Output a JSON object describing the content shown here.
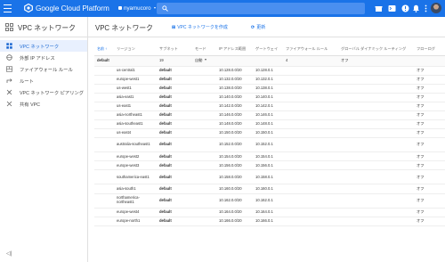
{
  "topbar": {
    "brand": "Google Cloud Platform",
    "project": "nyamucoro",
    "accent": "#1a73e8"
  },
  "sidebar": {
    "title": "VPC ネットワーク",
    "items": [
      {
        "label": "VPC ネットワーク",
        "icon": "vpc-network-icon",
        "active": true
      },
      {
        "label": "外部 IP アドレス",
        "icon": "ip-address-icon"
      },
      {
        "label": "ファイアウォール ルール",
        "icon": "firewall-icon"
      },
      {
        "label": "ルート",
        "icon": "route-icon"
      },
      {
        "label": "VPC ネットワーク ピアリング",
        "icon": "peering-icon"
      },
      {
        "label": "共有 VPC",
        "icon": "shared-vpc-icon"
      }
    ],
    "collapse": "◁|"
  },
  "main": {
    "title": "VPC ネットワーク",
    "create_label": "VPC ネットワークを作成",
    "refresh_label": "更新"
  },
  "table": {
    "headers": [
      "名前 ↑",
      "リージョン",
      "サブネット",
      "モード",
      "IP アドレス範囲",
      "ゲートウェイ",
      "ファイアウォール ルール",
      "グローバル ダイナミック ルーティング",
      "フローログ"
    ],
    "network": {
      "name": "default",
      "subnets": "19",
      "mode": "自動",
      "firewall": "4",
      "routing": "オフ"
    },
    "rows": [
      {
        "region": "us-central1",
        "subnet": "default",
        "range": "10.128.0.0/20",
        "gateway": "10.128.0.1",
        "flow": "オフ"
      },
      {
        "region": "europe-west1",
        "subnet": "default",
        "range": "10.132.0.0/20",
        "gateway": "10.132.0.1",
        "flow": "オフ"
      },
      {
        "region": "us-west1",
        "subnet": "default",
        "range": "10.138.0.0/20",
        "gateway": "10.138.0.1",
        "flow": "オフ"
      },
      {
        "region": "asia-east1",
        "subnet": "default",
        "range": "10.140.0.0/20",
        "gateway": "10.140.0.1",
        "flow": "オフ"
      },
      {
        "region": "us-east1",
        "subnet": "default",
        "range": "10.142.0.0/20",
        "gateway": "10.142.0.1",
        "flow": "オフ"
      },
      {
        "region": "asia-northeast1",
        "subnet": "default",
        "range": "10.146.0.0/20",
        "gateway": "10.146.0.1",
        "flow": "オフ"
      },
      {
        "region": "asia-southeast1",
        "subnet": "default",
        "range": "10.148.0.0/20",
        "gateway": "10.148.0.1",
        "flow": "オフ"
      },
      {
        "region": "us-east4",
        "subnet": "default",
        "range": "10.150.0.0/20",
        "gateway": "10.150.0.1",
        "flow": "オフ"
      },
      {
        "region": "australia-southeast1",
        "subnet": "default",
        "range": "10.152.0.0/20",
        "gateway": "10.152.0.1",
        "flow": "オフ"
      },
      {
        "region": "europe-west2",
        "subnet": "default",
        "range": "10.154.0.0/20",
        "gateway": "10.154.0.1",
        "flow": "オフ"
      },
      {
        "region": "europe-west3",
        "subnet": "default",
        "range": "10.156.0.0/20",
        "gateway": "10.156.0.1",
        "flow": "オフ"
      },
      {
        "region": "southamerica-east1",
        "subnet": "default",
        "range": "10.158.0.0/20",
        "gateway": "10.158.0.1",
        "flow": "オフ"
      },
      {
        "region": "asia-south1",
        "subnet": "default",
        "range": "10.160.0.0/20",
        "gateway": "10.160.0.1",
        "flow": "オフ"
      },
      {
        "region": "northamerica-northeast1",
        "subnet": "default",
        "range": "10.162.0.0/20",
        "gateway": "10.162.0.1",
        "flow": "オフ"
      },
      {
        "region": "europe-west4",
        "subnet": "default",
        "range": "10.164.0.0/20",
        "gateway": "10.164.0.1",
        "flow": "オフ"
      },
      {
        "region": "europe-north1",
        "subnet": "default",
        "range": "10.166.0.0/20",
        "gateway": "10.166.0.1",
        "flow": "オフ"
      }
    ]
  }
}
